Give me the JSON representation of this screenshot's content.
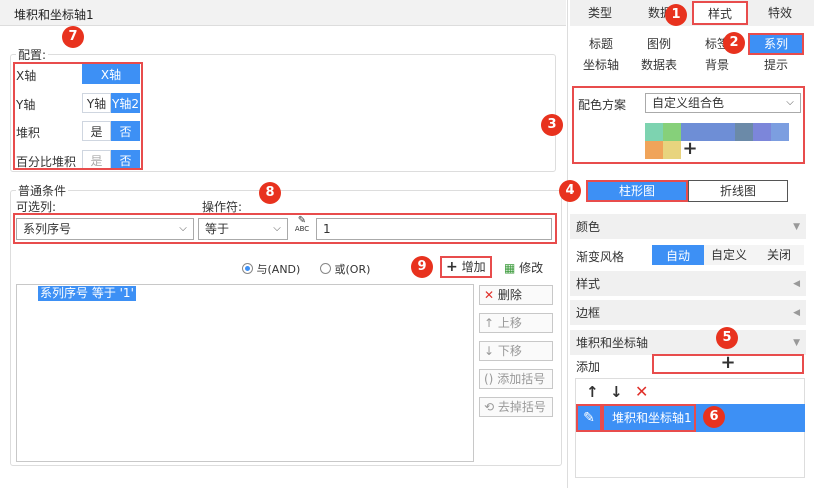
{
  "dialog": {
    "title": "堆积和坐标轴1"
  },
  "config": {
    "legend": "配置:",
    "rows": [
      {
        "label": "X轴",
        "opts": [
          "X轴"
        ]
      },
      {
        "label": "Y轴",
        "opts": [
          "Y轴",
          "Y轴2"
        ]
      },
      {
        "label": "堆积",
        "opts": [
          "是",
          "否"
        ]
      },
      {
        "label": "百分比堆积",
        "opts": [
          "是",
          "否"
        ]
      }
    ]
  },
  "condition": {
    "legend": "普通条件",
    "col_label": "可选列:",
    "op_label": "操作符:",
    "col_value": "系列序号",
    "op_value": "等于",
    "formula_icon_text": "ABC",
    "value": "1",
    "radio_and": "与(AND)",
    "radio_or": "或(OR)",
    "add": "增加",
    "modify": "修改",
    "list": [
      "系列序号 等于 '1'"
    ],
    "side": {
      "delete": "删除",
      "up": "上移",
      "down": "下移",
      "add_bracket": "添加括号",
      "remove_bracket": "去掉括号"
    }
  },
  "right": {
    "tabs": [
      "类型",
      "数据",
      "样式",
      "特效"
    ],
    "subtabs_row1": [
      "标题",
      "图例",
      "标签",
      "系列"
    ],
    "subtabs_row2": [
      "坐标轴",
      "数据表",
      "背景",
      "提示"
    ],
    "color_scheme_label": "配色方案",
    "color_scheme_value": "自定义组合色",
    "swatches": [
      "#7dd3b0",
      "#86d07a",
      "#6e8ed6",
      "#6e8ed6",
      "#6b8aa8",
      "#7c86da",
      "#7c9ee0",
      "#f0a45a",
      "#e8d47e",
      "#9a78c8"
    ],
    "chart_types": [
      "柱形图",
      "折线图"
    ],
    "sections": {
      "color": "颜色",
      "gradient": "渐变风格",
      "style": "样式",
      "border": "边框",
      "stack": "堆积和坐标轴",
      "add": "添加"
    },
    "gradient_opts": [
      "自动",
      "自定义",
      "关闭"
    ],
    "stack_item": "堆积和坐标轴1"
  },
  "badges": [
    "1",
    "2",
    "3",
    "4",
    "5",
    "6",
    "7",
    "8",
    "9"
  ]
}
